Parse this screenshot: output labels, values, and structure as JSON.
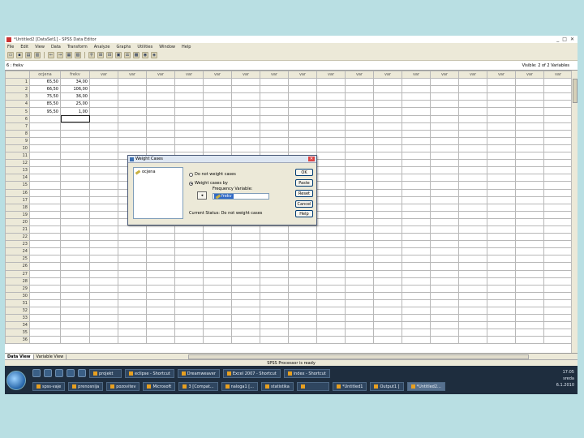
{
  "window": {
    "title": "*Untitled2 [DataSet1] - SPSS Data Editor",
    "controls": [
      "_",
      "□",
      "✕"
    ]
  },
  "menu": [
    "File",
    "Edit",
    "View",
    "Data",
    "Transform",
    "Analyze",
    "Graphs",
    "Utilities",
    "Window",
    "Help"
  ],
  "cellbar": {
    "reference": "6 : frekv",
    "value": "",
    "visible": "Visible: 2 of 2 Variables"
  },
  "grid": {
    "headers": [
      "ocjena",
      "frekv",
      "var",
      "var",
      "var",
      "var",
      "var",
      "var",
      "var",
      "var",
      "var",
      "var",
      "var",
      "var",
      "var",
      "var",
      "var",
      "var",
      "var"
    ],
    "rows": [
      [
        "65,50",
        "34,00"
      ],
      [
        "66,50",
        "106,00"
      ],
      [
        "75,50",
        "36,00"
      ],
      [
        "85,50",
        "25,00"
      ],
      [
        "95,50",
        "1,00"
      ]
    ],
    "row_count": 36
  },
  "tabs": {
    "data_view": "Data View",
    "variable_view": "Variable View"
  },
  "status": "SPSS Processor is ready",
  "dialog": {
    "title": "Weight Cases",
    "variables": [
      "ocjena"
    ],
    "options": {
      "none": "Do not weight cases",
      "weight": "Weight cases by"
    },
    "selected_option": "weight",
    "frequency_label": "Frequency Variable:",
    "frequency_value": "frekv",
    "current_status": "Current Status: Do not weight cases",
    "buttons": {
      "ok": "OK",
      "paste": "Paste",
      "reset": "Reset",
      "cancel": "Cancel",
      "help": "Help"
    }
  },
  "taskbar": {
    "row1": [
      "projekt",
      "eclipse - Shortcut",
      "Dreamweaver",
      "Excel 2007 - Shortcut",
      "index - Shortcut"
    ],
    "row2": [
      "spss-vaje",
      "prenosnija",
      "pozovitev",
      "Microsoft",
      "3 [Compat...",
      "naloga1 [...",
      "statistika",
      "",
      "*Untitled1",
      "Output1 [",
      "*Untitled2..."
    ],
    "active_index": 10,
    "clock": "17:05",
    "day": "sreda",
    "date": "6.1.2010"
  },
  "colors": {
    "background": "#b9dfe3",
    "selection": "#316ac5",
    "taskbar": "#1e2d3e"
  }
}
